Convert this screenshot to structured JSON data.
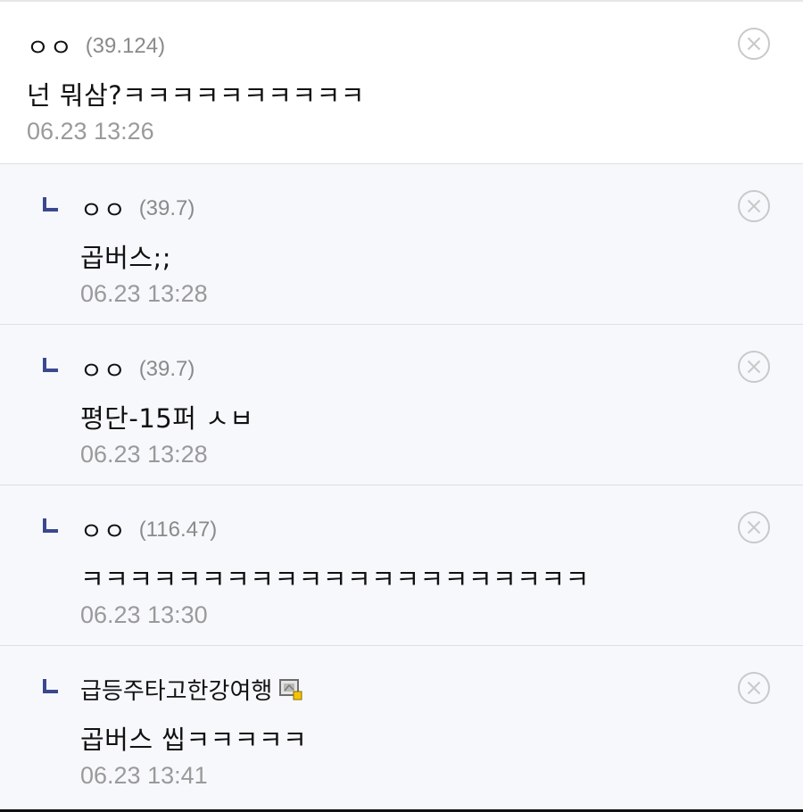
{
  "comments": [
    {
      "nickname": "ㅇㅇ",
      "ip": "(39.124)",
      "text": "넌 뭐삼?ㅋㅋㅋㅋㅋㅋㅋㅋㅋㅋ",
      "datetime": "06.23 13:26",
      "is_reply": false
    },
    {
      "nickname": "ㅇㅇ",
      "ip": "(39.7)",
      "text": "곱버스;;",
      "datetime": "06.23 13:28",
      "is_reply": true
    },
    {
      "nickname": "ㅇㅇ",
      "ip": "(39.7)",
      "text": "평단-15퍼 ㅅㅂ",
      "datetime": "06.23 13:28",
      "is_reply": true
    },
    {
      "nickname": "ㅇㅇ",
      "ip": "(116.47)",
      "text": "ㅋㅋㅋㅋㅋㅋㅋㅋㅋㅋㅋㅋㅋㅋㅋㅋㅋㅋㅋㅋㅋ",
      "datetime": "06.23 13:30",
      "is_reply": true
    },
    {
      "nickname": "급등주타고한강여행",
      "ip": "",
      "text": "곱버스 씹ㅋㅋㅋㅋㅋ",
      "datetime": "06.23 13:41",
      "is_reply": true,
      "member_icon": "fixed-nick-icon"
    }
  ],
  "icons": {
    "delete": "circle-x-icon",
    "reply": "reply-arrow-icon"
  },
  "colors": {
    "reply_background": "#f7f8fb",
    "reply_arrow": "#3b4890",
    "meta_gray": "#9a9a9a"
  }
}
